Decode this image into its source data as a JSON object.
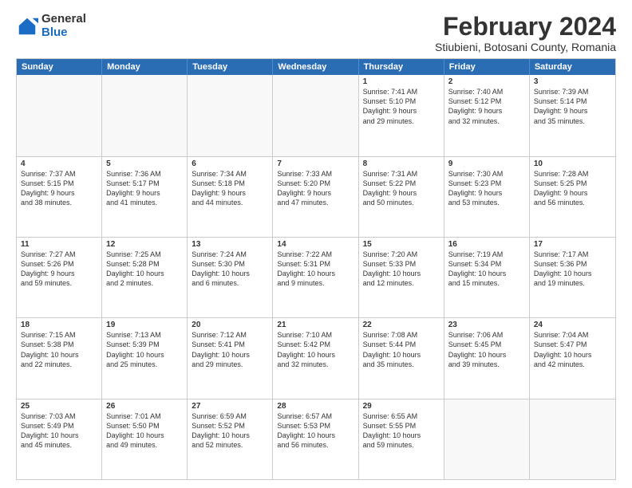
{
  "header": {
    "logo_general": "General",
    "logo_blue": "Blue",
    "title": "February 2024",
    "subtitle": "Stiubieni, Botosani County, Romania"
  },
  "days_of_week": [
    "Sunday",
    "Monday",
    "Tuesday",
    "Wednesday",
    "Thursday",
    "Friday",
    "Saturday"
  ],
  "weeks": [
    [
      {
        "day": "",
        "empty": true
      },
      {
        "day": "",
        "empty": true
      },
      {
        "day": "",
        "empty": true
      },
      {
        "day": "",
        "empty": true
      },
      {
        "day": "1",
        "lines": [
          "Sunrise: 7:41 AM",
          "Sunset: 5:10 PM",
          "Daylight: 9 hours",
          "and 29 minutes."
        ]
      },
      {
        "day": "2",
        "lines": [
          "Sunrise: 7:40 AM",
          "Sunset: 5:12 PM",
          "Daylight: 9 hours",
          "and 32 minutes."
        ]
      },
      {
        "day": "3",
        "lines": [
          "Sunrise: 7:39 AM",
          "Sunset: 5:14 PM",
          "Daylight: 9 hours",
          "and 35 minutes."
        ]
      }
    ],
    [
      {
        "day": "4",
        "lines": [
          "Sunrise: 7:37 AM",
          "Sunset: 5:15 PM",
          "Daylight: 9 hours",
          "and 38 minutes."
        ]
      },
      {
        "day": "5",
        "lines": [
          "Sunrise: 7:36 AM",
          "Sunset: 5:17 PM",
          "Daylight: 9 hours",
          "and 41 minutes."
        ]
      },
      {
        "day": "6",
        "lines": [
          "Sunrise: 7:34 AM",
          "Sunset: 5:18 PM",
          "Daylight: 9 hours",
          "and 44 minutes."
        ]
      },
      {
        "day": "7",
        "lines": [
          "Sunrise: 7:33 AM",
          "Sunset: 5:20 PM",
          "Daylight: 9 hours",
          "and 47 minutes."
        ]
      },
      {
        "day": "8",
        "lines": [
          "Sunrise: 7:31 AM",
          "Sunset: 5:22 PM",
          "Daylight: 9 hours",
          "and 50 minutes."
        ]
      },
      {
        "day": "9",
        "lines": [
          "Sunrise: 7:30 AM",
          "Sunset: 5:23 PM",
          "Daylight: 9 hours",
          "and 53 minutes."
        ]
      },
      {
        "day": "10",
        "lines": [
          "Sunrise: 7:28 AM",
          "Sunset: 5:25 PM",
          "Daylight: 9 hours",
          "and 56 minutes."
        ]
      }
    ],
    [
      {
        "day": "11",
        "lines": [
          "Sunrise: 7:27 AM",
          "Sunset: 5:26 PM",
          "Daylight: 9 hours",
          "and 59 minutes."
        ]
      },
      {
        "day": "12",
        "lines": [
          "Sunrise: 7:25 AM",
          "Sunset: 5:28 PM",
          "Daylight: 10 hours",
          "and 2 minutes."
        ]
      },
      {
        "day": "13",
        "lines": [
          "Sunrise: 7:24 AM",
          "Sunset: 5:30 PM",
          "Daylight: 10 hours",
          "and 6 minutes."
        ]
      },
      {
        "day": "14",
        "lines": [
          "Sunrise: 7:22 AM",
          "Sunset: 5:31 PM",
          "Daylight: 10 hours",
          "and 9 minutes."
        ]
      },
      {
        "day": "15",
        "lines": [
          "Sunrise: 7:20 AM",
          "Sunset: 5:33 PM",
          "Daylight: 10 hours",
          "and 12 minutes."
        ]
      },
      {
        "day": "16",
        "lines": [
          "Sunrise: 7:19 AM",
          "Sunset: 5:34 PM",
          "Daylight: 10 hours",
          "and 15 minutes."
        ]
      },
      {
        "day": "17",
        "lines": [
          "Sunrise: 7:17 AM",
          "Sunset: 5:36 PM",
          "Daylight: 10 hours",
          "and 19 minutes."
        ]
      }
    ],
    [
      {
        "day": "18",
        "lines": [
          "Sunrise: 7:15 AM",
          "Sunset: 5:38 PM",
          "Daylight: 10 hours",
          "and 22 minutes."
        ]
      },
      {
        "day": "19",
        "lines": [
          "Sunrise: 7:13 AM",
          "Sunset: 5:39 PM",
          "Daylight: 10 hours",
          "and 25 minutes."
        ]
      },
      {
        "day": "20",
        "lines": [
          "Sunrise: 7:12 AM",
          "Sunset: 5:41 PM",
          "Daylight: 10 hours",
          "and 29 minutes."
        ]
      },
      {
        "day": "21",
        "lines": [
          "Sunrise: 7:10 AM",
          "Sunset: 5:42 PM",
          "Daylight: 10 hours",
          "and 32 minutes."
        ]
      },
      {
        "day": "22",
        "lines": [
          "Sunrise: 7:08 AM",
          "Sunset: 5:44 PM",
          "Daylight: 10 hours",
          "and 35 minutes."
        ]
      },
      {
        "day": "23",
        "lines": [
          "Sunrise: 7:06 AM",
          "Sunset: 5:45 PM",
          "Daylight: 10 hours",
          "and 39 minutes."
        ]
      },
      {
        "day": "24",
        "lines": [
          "Sunrise: 7:04 AM",
          "Sunset: 5:47 PM",
          "Daylight: 10 hours",
          "and 42 minutes."
        ]
      }
    ],
    [
      {
        "day": "25",
        "lines": [
          "Sunrise: 7:03 AM",
          "Sunset: 5:49 PM",
          "Daylight: 10 hours",
          "and 45 minutes."
        ]
      },
      {
        "day": "26",
        "lines": [
          "Sunrise: 7:01 AM",
          "Sunset: 5:50 PM",
          "Daylight: 10 hours",
          "and 49 minutes."
        ]
      },
      {
        "day": "27",
        "lines": [
          "Sunrise: 6:59 AM",
          "Sunset: 5:52 PM",
          "Daylight: 10 hours",
          "and 52 minutes."
        ]
      },
      {
        "day": "28",
        "lines": [
          "Sunrise: 6:57 AM",
          "Sunset: 5:53 PM",
          "Daylight: 10 hours",
          "and 56 minutes."
        ]
      },
      {
        "day": "29",
        "lines": [
          "Sunrise: 6:55 AM",
          "Sunset: 5:55 PM",
          "Daylight: 10 hours",
          "and 59 minutes."
        ]
      },
      {
        "day": "",
        "empty": true
      },
      {
        "day": "",
        "empty": true
      }
    ]
  ]
}
